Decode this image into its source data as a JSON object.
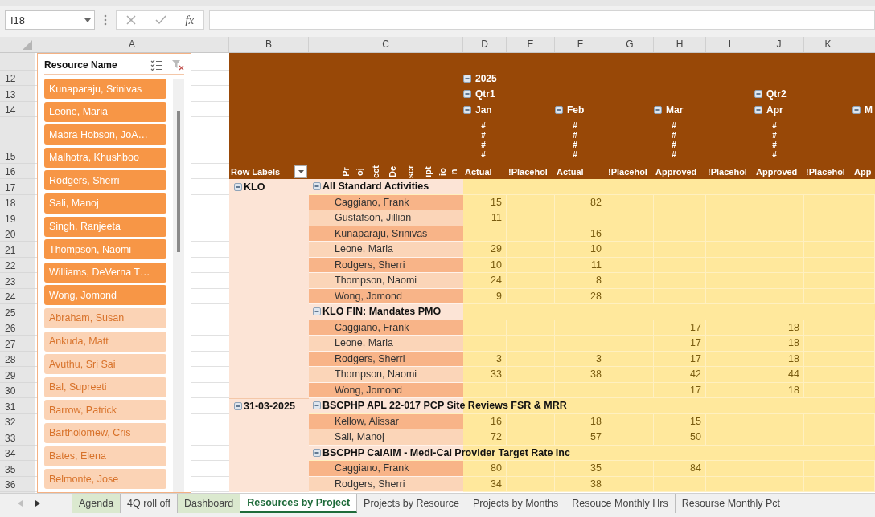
{
  "formula_bar": {
    "name_box": "I18",
    "function_label": "fx"
  },
  "columns": [
    "A",
    "B",
    "C",
    "D",
    "E",
    "F",
    "G",
    "H",
    "I",
    "J",
    "K"
  ],
  "slicer": {
    "title": "Resource Name",
    "items": [
      {
        "label": "Kunaparaju, Srinivas",
        "selected": true
      },
      {
        "label": "Leone, Maria",
        "selected": true
      },
      {
        "label": "Mabra Hobson, JoA…",
        "selected": true
      },
      {
        "label": "Malhotra, Khushboo",
        "selected": true
      },
      {
        "label": "Rodgers, Sherri",
        "selected": true
      },
      {
        "label": "Sali, Manoj",
        "selected": true
      },
      {
        "label": "Singh, Ranjeeta",
        "selected": true
      },
      {
        "label": "Thompson, Naomi",
        "selected": true
      },
      {
        "label": "Williams, DeVerna T…",
        "selected": true
      },
      {
        "label": "Wong, Jomond",
        "selected": true
      },
      {
        "label": "Abraham, Susan",
        "selected": false
      },
      {
        "label": "Ankuda, Matt",
        "selected": false
      },
      {
        "label": "Avuthu, Sri Sai",
        "selected": false
      },
      {
        "label": "Bal, Supreeti",
        "selected": false
      },
      {
        "label": "Barrow, Patrick",
        "selected": false
      },
      {
        "label": "Bartholomew, Cris",
        "selected": false
      },
      {
        "label": "Bates, Elena",
        "selected": false
      },
      {
        "label": "Belmonte, Jose",
        "selected": false
      }
    ]
  },
  "pivot": {
    "date_rows": [
      {
        "number": "12",
        "cells": {
          "D": {
            "label": "2025",
            "expanded": true
          }
        }
      },
      {
        "number": "13",
        "cells": {
          "D": {
            "label": "Qtr1",
            "expanded": true
          },
          "J": {
            "label": "Qtr2",
            "expanded": true
          }
        }
      },
      {
        "number": "14",
        "cells": {
          "D": {
            "label": "Jan",
            "expanded": true
          },
          "F": {
            "label": "Feb",
            "expanded": true
          },
          "H": {
            "label": "Mar",
            "expanded": true
          },
          "J": {
            "label": "Apr",
            "expanded": true
          },
          "L": {
            "label": "M",
            "expanded": true
          }
        }
      }
    ],
    "hash_row": {
      "number": "15",
      "cells": {
        "D": "####",
        "F": "####",
        "H": "####",
        "J": "####"
      }
    },
    "heading_row": {
      "number": "16",
      "row_labels": "Row Labels",
      "description_fragments": [
        "Pr",
        "oj",
        "ect",
        "De",
        "scr",
        "ipt",
        "io",
        "n"
      ],
      "cells": {
        "D": "Actual",
        "E": "!Placehol",
        "F": "Actual",
        "G": "!Placehol",
        "H": "Approved",
        "I": "!Placehol",
        "J": "Approved",
        "K": "!Placehol",
        "L": "App"
      }
    },
    "rows": [
      {
        "number": "17",
        "kind": "group",
        "region": {
          "label": "KLO",
          "expanded": true
        },
        "label": "All Standard Activities",
        "expanded": true
      },
      {
        "number": "18",
        "kind": "member",
        "label": "Caggiano, Frank",
        "values": {
          "D": "15",
          "F": "82"
        }
      },
      {
        "number": "19",
        "kind": "member",
        "label": "Gustafson, Jillian",
        "values": {
          "D": "11"
        }
      },
      {
        "number": "20",
        "kind": "member",
        "label": "Kunaparaju, Srinivas",
        "values": {
          "F": "16"
        }
      },
      {
        "number": "21",
        "kind": "member",
        "label": "Leone, Maria",
        "values": {
          "D": "29",
          "F": "10"
        }
      },
      {
        "number": "22",
        "kind": "member",
        "label": "Rodgers, Sherri",
        "values": {
          "D": "10",
          "F": "11"
        }
      },
      {
        "number": "23",
        "kind": "member",
        "label": "Thompson, Naomi",
        "values": {
          "D": "24",
          "F": "8"
        }
      },
      {
        "number": "24",
        "kind": "member",
        "label": "Wong, Jomond",
        "values": {
          "D": "9",
          "F": "28"
        }
      },
      {
        "number": "25",
        "kind": "group",
        "label": "KLO FIN: Mandates PMO",
        "expanded": true
      },
      {
        "number": "26",
        "kind": "member",
        "label": "Caggiano, Frank",
        "values": {
          "H": "17",
          "J": "18"
        }
      },
      {
        "number": "27",
        "kind": "member",
        "label": "Leone, Maria",
        "values": {
          "H": "17",
          "J": "18"
        }
      },
      {
        "number": "28",
        "kind": "member",
        "label": "Rodgers, Sherri",
        "values": {
          "D": "3",
          "F": "3",
          "H": "17",
          "J": "18"
        }
      },
      {
        "number": "29",
        "kind": "member",
        "label": "Thompson, Naomi",
        "values": {
          "D": "33",
          "F": "38",
          "H": "42",
          "J": "44"
        }
      },
      {
        "number": "30",
        "kind": "member",
        "label": "Wong, Jomond",
        "values": {
          "H": "17",
          "J": "18"
        }
      },
      {
        "number": "31",
        "kind": "group",
        "region": {
          "label": "31-03-2025",
          "expanded": true
        },
        "label": "BSCPHP APL 22-017 PCP Site Reviews FSR & MRR",
        "expanded": true
      },
      {
        "number": "32",
        "kind": "member",
        "label": "Kellow, Alissar",
        "values": {
          "D": "16",
          "F": "18",
          "H": "15"
        }
      },
      {
        "number": "33",
        "kind": "member",
        "label": "Sali, Manoj",
        "values": {
          "D": "72",
          "F": "57",
          "H": "50"
        }
      },
      {
        "number": "34",
        "kind": "group",
        "label": "BSCPHP CalAIM - Medi-Cal Provider Target Rate Inc",
        "expanded": true
      },
      {
        "number": "35",
        "kind": "member",
        "label": "Caggiano, Frank",
        "values": {
          "D": "80",
          "F": "35",
          "H": "84"
        }
      },
      {
        "number": "36",
        "kind": "member",
        "label": "Rodgers, Sherri",
        "values": {
          "D": "34",
          "F": "38"
        }
      }
    ]
  },
  "sheet_tabs": [
    {
      "label": "Agenda",
      "selected": false,
      "color": "#dbe9cf"
    },
    {
      "label": "4Q roll off",
      "selected": false
    },
    {
      "label": "Dashboard",
      "selected": false,
      "color": "#dbe9cf"
    },
    {
      "label": "Resources by Project",
      "selected": true
    },
    {
      "label": "Projects by Resource",
      "selected": false
    },
    {
      "label": "Projects by Months",
      "selected": false
    },
    {
      "label": "Resouce Monthly Hrs",
      "selected": false
    },
    {
      "label": "Resourse Monthly Pct",
      "selected": false
    }
  ]
}
